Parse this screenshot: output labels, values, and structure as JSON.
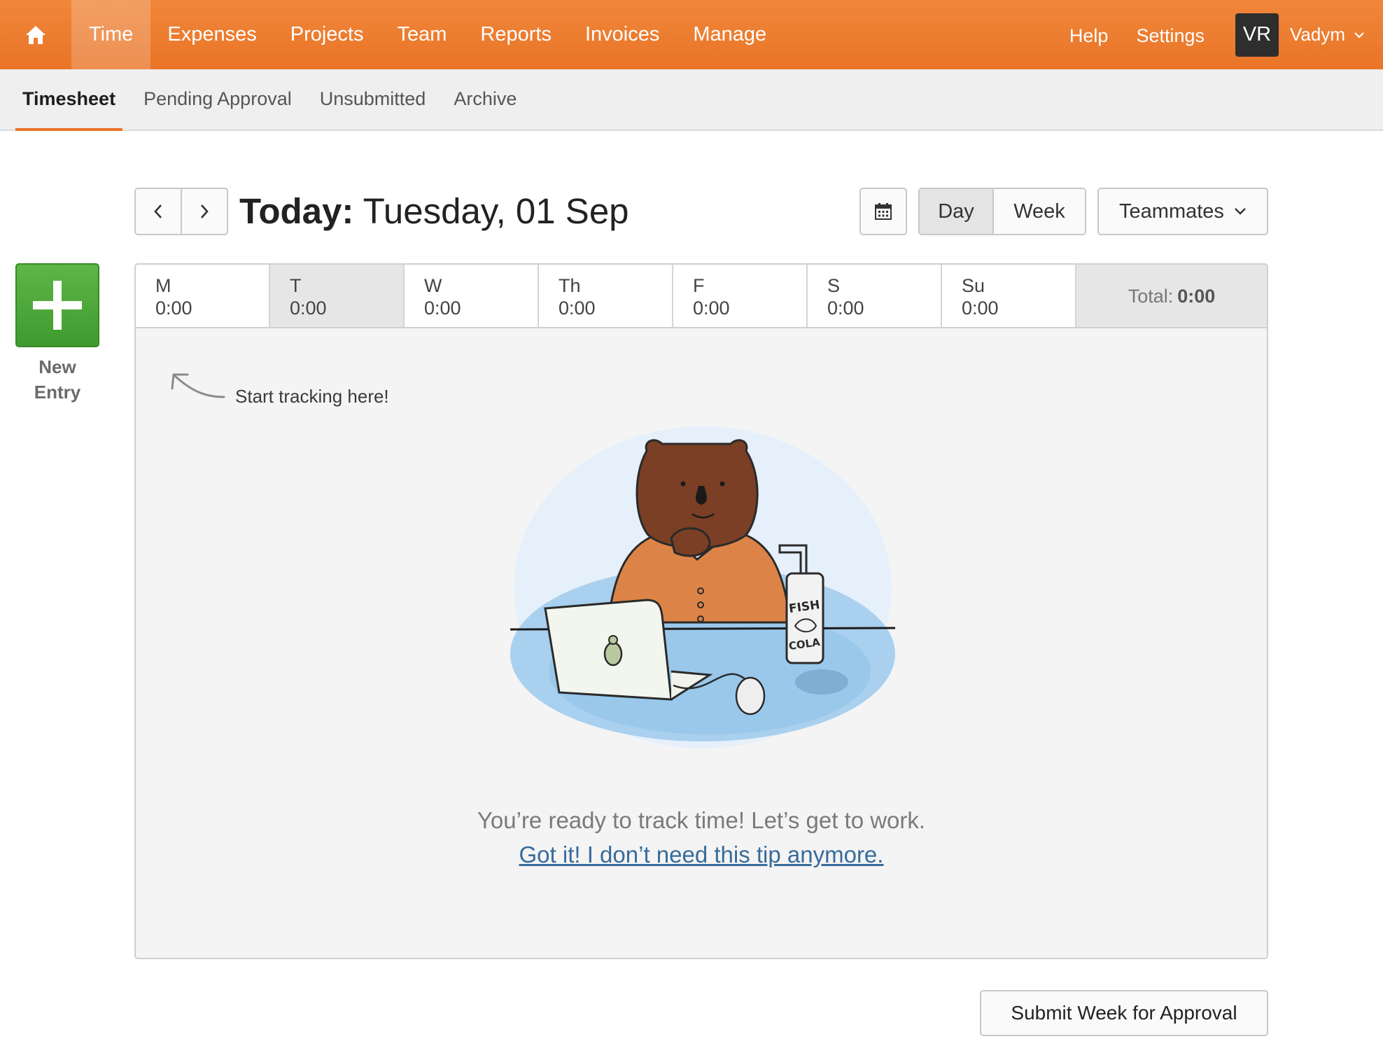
{
  "topnav": {
    "items": [
      {
        "label": "Time",
        "active": true
      },
      {
        "label": "Expenses"
      },
      {
        "label": "Projects"
      },
      {
        "label": "Team"
      },
      {
        "label": "Reports"
      },
      {
        "label": "Invoices"
      },
      {
        "label": "Manage"
      }
    ],
    "help": "Help",
    "settings": "Settings",
    "user": {
      "initials": "VR",
      "name": "Vadym"
    },
    "accent_color": "#e97427"
  },
  "subnav": {
    "items": [
      {
        "label": "Timesheet",
        "active": true
      },
      {
        "label": "Pending Approval"
      },
      {
        "label": "Unsubmitted"
      },
      {
        "label": "Archive"
      }
    ]
  },
  "new_entry": {
    "line1": "New",
    "line2": "Entry",
    "color": "#4da83a"
  },
  "date_header": {
    "today_label": "Today:",
    "date": "Tuesday, 01 Sep",
    "view_day": "Day",
    "view_week": "Week",
    "teammates": "Teammates"
  },
  "week": {
    "days": [
      {
        "name": "M",
        "hours": "0:00"
      },
      {
        "name": "T",
        "hours": "0:00",
        "active": true
      },
      {
        "name": "W",
        "hours": "0:00"
      },
      {
        "name": "Th",
        "hours": "0:00"
      },
      {
        "name": "F",
        "hours": "0:00"
      },
      {
        "name": "S",
        "hours": "0:00"
      },
      {
        "name": "Su",
        "hours": "0:00"
      }
    ],
    "total_label": "Total:",
    "total_value": "0:00"
  },
  "panel": {
    "hint": "Start tracking here!",
    "illustration": {
      "can_text_1": "FISH",
      "can_text_2": "COLA"
    },
    "message": "You’re ready to track time! Let’s get to work.",
    "dismiss": "Got it! I don’t need this tip anymore."
  },
  "submit": "Submit Week for Approval"
}
